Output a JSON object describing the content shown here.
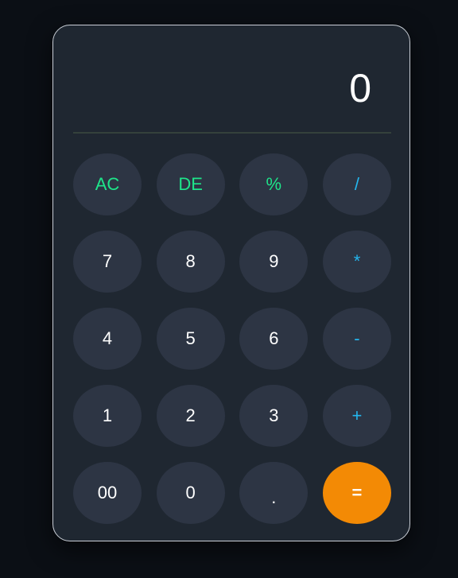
{
  "display": {
    "value": "0"
  },
  "keys": [
    {
      "label": "AC",
      "name": "clear-all-button",
      "kind": "fn"
    },
    {
      "label": "DE",
      "name": "delete-button",
      "kind": "fn"
    },
    {
      "label": "%",
      "name": "percent-button",
      "kind": "fn"
    },
    {
      "label": "/",
      "name": "divide-button",
      "kind": "op"
    },
    {
      "label": "7",
      "name": "digit-7-button",
      "kind": "num"
    },
    {
      "label": "8",
      "name": "digit-8-button",
      "kind": "num"
    },
    {
      "label": "9",
      "name": "digit-9-button",
      "kind": "num"
    },
    {
      "label": "*",
      "name": "multiply-button",
      "kind": "op"
    },
    {
      "label": "4",
      "name": "digit-4-button",
      "kind": "num"
    },
    {
      "label": "5",
      "name": "digit-5-button",
      "kind": "num"
    },
    {
      "label": "6",
      "name": "digit-6-button",
      "kind": "num"
    },
    {
      "label": "-",
      "name": "subtract-button",
      "kind": "op"
    },
    {
      "label": "1",
      "name": "digit-1-button",
      "kind": "num"
    },
    {
      "label": "2",
      "name": "digit-2-button",
      "kind": "num"
    },
    {
      "label": "3",
      "name": "digit-3-button",
      "kind": "num"
    },
    {
      "label": "+",
      "name": "add-button",
      "kind": "op"
    },
    {
      "label": "00",
      "name": "double-zero-button",
      "kind": "num"
    },
    {
      "label": "0",
      "name": "digit-0-button",
      "kind": "num"
    },
    {
      "label": ".",
      "name": "decimal-button",
      "kind": "dot"
    },
    {
      "label": "=",
      "name": "equals-button",
      "kind": "eq"
    }
  ],
  "colors": {
    "page_background": "#0b0f15",
    "panel_background": "#1f2731",
    "key_background": "#2d3544",
    "function_key_text": "#1ee58a",
    "operator_key_text": "#24b6ee",
    "equals_background": "#f38a05"
  }
}
